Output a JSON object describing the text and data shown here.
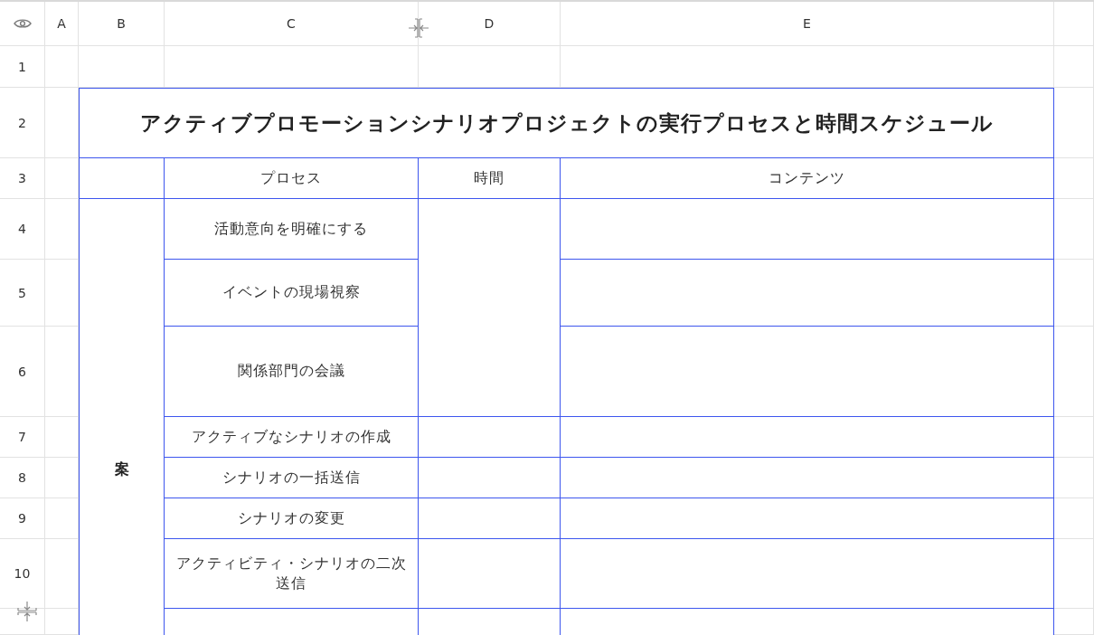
{
  "column_headers": [
    "A",
    "B",
    "C",
    "D",
    "E"
  ],
  "row_headers": [
    "1",
    "2",
    "3",
    "4",
    "5",
    "6",
    "7",
    "8",
    "9",
    "10"
  ],
  "table": {
    "title": "アクティブプロモーションシナリオプロジェクトの実行プロセスと時間スケジュール",
    "header": [
      "プロセス",
      "時間",
      "コンテンツ"
    ],
    "group_label": "案",
    "steps": [
      "活動意向を明確にする",
      "イベントの現場視察",
      "関係部門の会議",
      "アクティブなシナリオの作成",
      "シナリオの一括送信",
      "シナリオの変更",
      "アクティビティ・シナリオの二次送信"
    ]
  }
}
